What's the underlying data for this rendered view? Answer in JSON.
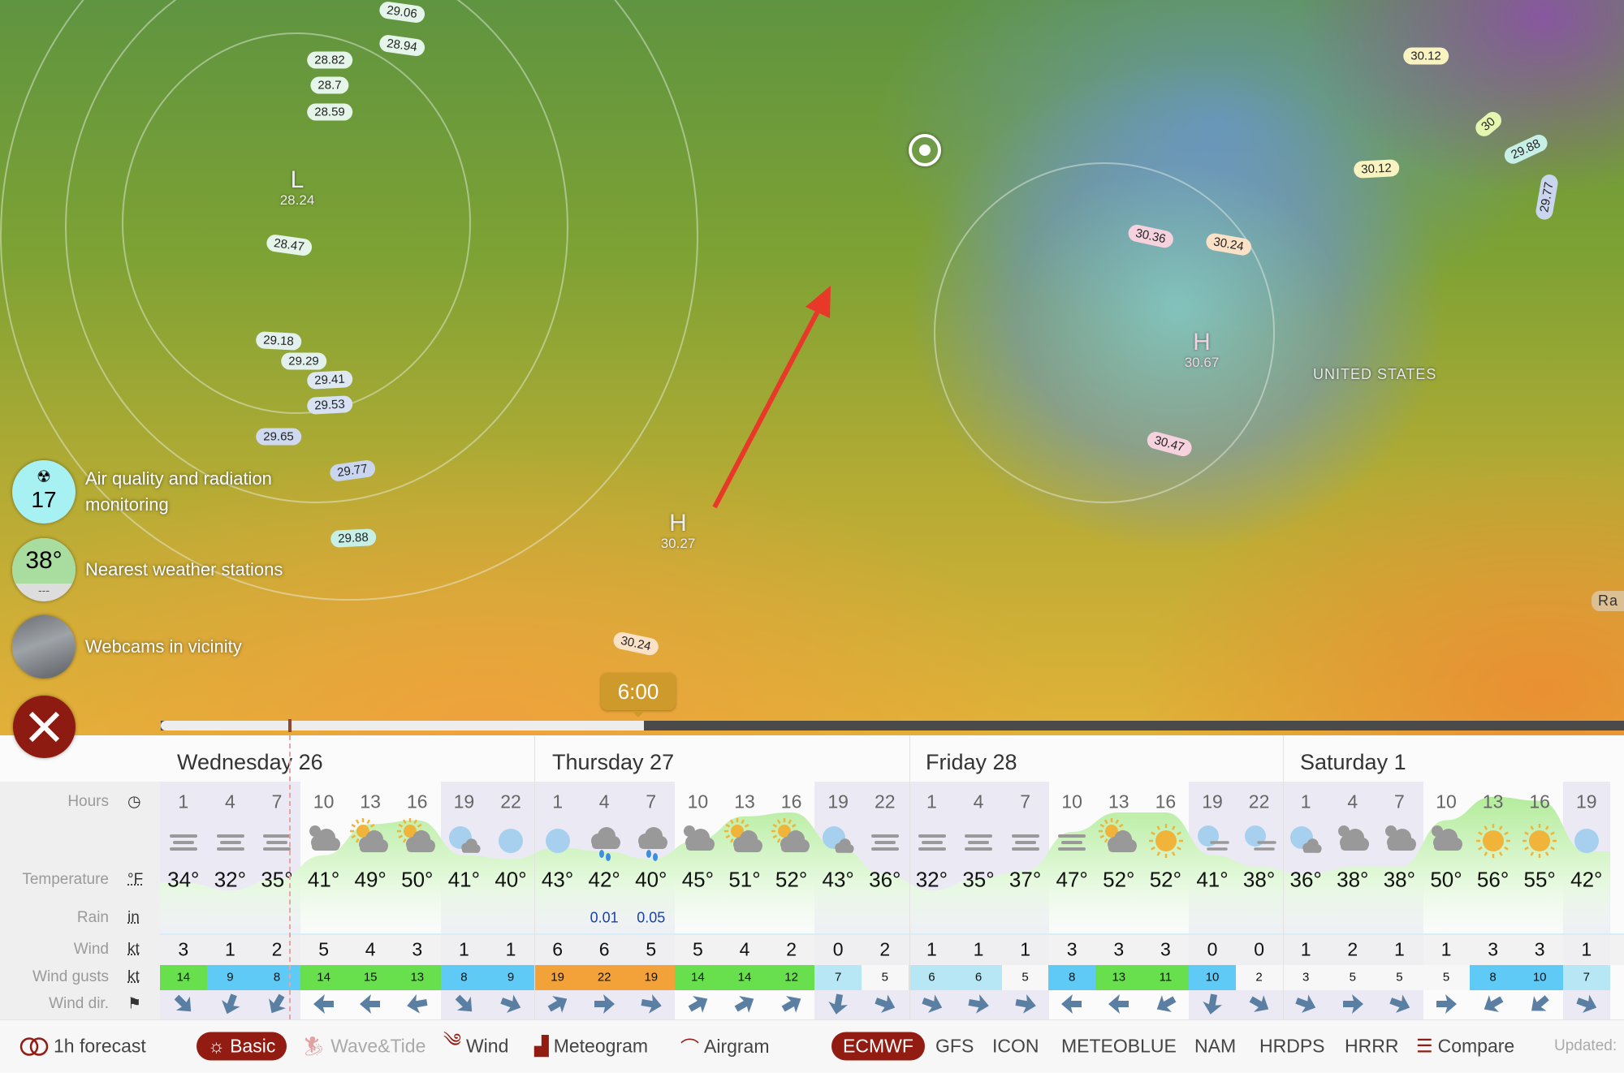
{
  "map": {
    "isobars": [
      {
        "v": "29.06",
        "c": "#e6f5ea"
      },
      {
        "v": "28.94",
        "c": "#e6f5ea"
      },
      {
        "v": "28.82",
        "c": "#e6f5ea"
      },
      {
        "v": "28.7",
        "c": "#e6f5ea"
      },
      {
        "v": "28.59",
        "c": "#e6f5ea"
      },
      {
        "v": "28.47",
        "c": "#e6f5ea"
      },
      {
        "v": "29.18",
        "c": "#e3f1ee"
      },
      {
        "v": "29.29",
        "c": "#e3f1ee"
      },
      {
        "v": "29.41",
        "c": "#dde8f2"
      },
      {
        "v": "29.53",
        "c": "#d6e2f3"
      },
      {
        "v": "29.65",
        "c": "#cfdaf1"
      },
      {
        "v": "29.77",
        "c": "#cad6f0"
      },
      {
        "v": "29.88",
        "c": "#c6efe6"
      },
      {
        "v": "30.24",
        "c": "#fbe1c6"
      },
      {
        "v": "30.36",
        "c": "#f6d2de"
      },
      {
        "v": "30.24",
        "c": "#fbe1c6"
      },
      {
        "v": "30.47",
        "c": "#f6d2de"
      },
      {
        "v": "30.12",
        "c": "#f8f3c0"
      },
      {
        "v": "30",
        "c": "#e5f6b0"
      },
      {
        "v": "29.88",
        "c": "#c6efe6"
      },
      {
        "v": "30.12",
        "c": "#f8f3c0"
      },
      {
        "v": "29.77",
        "c": "#cad6f0"
      }
    ],
    "pressure_centers": [
      {
        "type": "L",
        "value": "28.24"
      },
      {
        "type": "H",
        "value": "30.27"
      },
      {
        "type": "H",
        "value": "30.67"
      }
    ],
    "country_label": "UNITED STATES",
    "edge_label": "Ra"
  },
  "side": {
    "air_quality": {
      "value": "17",
      "label": "Air quality and radiation monitoring",
      "icon": "radiation-icon"
    },
    "stations": {
      "value": "38°",
      "sub": "---",
      "label": "Nearest weather stations"
    },
    "webcams": {
      "label": "Webcams in vicinity"
    }
  },
  "timeline": {
    "time": "6:00",
    "progress": 0.33
  },
  "forecast": {
    "row_labels": {
      "hours": "Hours",
      "temperature": "Temperature",
      "temp_unit": "°F",
      "rain": "Rain",
      "rain_unit": "in",
      "wind": "Wind",
      "wind_unit": "kt",
      "gusts": "Wind gusts",
      "gusts_unit": "kt",
      "dir": "Wind dir."
    },
    "days": [
      "Wednesday 26",
      "Thursday 27",
      "Friday 28",
      "Saturday 1"
    ],
    "hours": [
      1,
      4,
      7,
      10,
      13,
      16,
      19,
      22,
      1,
      4,
      7,
      10,
      13,
      16,
      19,
      22,
      1,
      4,
      7,
      10,
      13,
      16,
      19,
      22,
      1,
      4,
      7,
      10,
      13,
      16,
      19
    ],
    "night": [
      1,
      1,
      1,
      0,
      0,
      0,
      1,
      1,
      1,
      1,
      1,
      0,
      0,
      0,
      1,
      1,
      1,
      1,
      1,
      0,
      0,
      0,
      1,
      1,
      1,
      1,
      1,
      0,
      0,
      0,
      1
    ],
    "icons": [
      "fog",
      "fog",
      "fog",
      "cloudy",
      "partly-sunny",
      "partly-sunny",
      "moon-cloud",
      "moon",
      "moon",
      "rain",
      "rain",
      "cloudy",
      "partly-sunny",
      "partly-sunny",
      "moon-cloud",
      "fog",
      "fog",
      "fog",
      "fog",
      "fog",
      "partly-sunny",
      "sun",
      "moon-fog",
      "moon-fog",
      "moon-cloud",
      "cloudy",
      "cloudy",
      "cloudy",
      "sun",
      "sun",
      "moon"
    ],
    "temps": [
      "34°",
      "32°",
      "35°",
      "41°",
      "49°",
      "50°",
      "41°",
      "40°",
      "43°",
      "42°",
      "40°",
      "45°",
      "51°",
      "52°",
      "43°",
      "36°",
      "32°",
      "35°",
      "37°",
      "47°",
      "52°",
      "52°",
      "41°",
      "38°",
      "36°",
      "38°",
      "38°",
      "50°",
      "56°",
      "55°",
      "42°"
    ],
    "rain": [
      "",
      "",
      "",
      "",
      "",
      "",
      "",
      "",
      "",
      "0.01",
      "0.05",
      "",
      "",
      "",
      "",
      "",
      "",
      "",
      "",
      "",
      "",
      "",
      "",
      "",
      "",
      "",
      "",
      "",
      "",
      "",
      ""
    ],
    "wind": [
      "3",
      "1",
      "2",
      "5",
      "4",
      "3",
      "1",
      "1",
      "6",
      "6",
      "5",
      "5",
      "4",
      "2",
      "0",
      "2",
      "1",
      "1",
      "1",
      "3",
      "3",
      "3",
      "0",
      "0",
      "1",
      "2",
      "1",
      "1",
      "3",
      "3",
      "1"
    ],
    "gusts": [
      "14",
      "9",
      "8",
      "14",
      "15",
      "13",
      "8",
      "9",
      "19",
      "22",
      "19",
      "14",
      "14",
      "12",
      "7",
      "5",
      "6",
      "6",
      "5",
      "8",
      "13",
      "11",
      "10",
      "2",
      "3",
      "5",
      "5",
      "5",
      "8",
      "10",
      "7"
    ],
    "wind_dir_deg": [
      135,
      200,
      210,
      270,
      270,
      260,
      135,
      110,
      60,
      90,
      100,
      60,
      60,
      60,
      190,
      110,
      110,
      100,
      100,
      270,
      270,
      240,
      190,
      120,
      110,
      90,
      110,
      90,
      240,
      230,
      110
    ]
  },
  "bottom": {
    "forecast_toggle": "1h forecast",
    "views": [
      {
        "label": "Basic",
        "active": true
      },
      {
        "label": "Wave&Tide",
        "disabled": true
      },
      {
        "label": "Wind"
      },
      {
        "label": "Meteogram"
      },
      {
        "label": "Airgram"
      }
    ],
    "models": [
      {
        "label": "ECMWF",
        "active": true
      },
      {
        "label": "GFS"
      },
      {
        "label": "ICON"
      },
      {
        "label": "METEOBLUE"
      },
      {
        "label": "NAM"
      },
      {
        "label": "HRDPS"
      },
      {
        "label": "HRRR"
      }
    ],
    "compare": "Compare",
    "updated": "Updated:"
  },
  "colors": {
    "accent": "#921c12",
    "night": "#ebeaf4",
    "arrow": "#5a7fa3"
  }
}
